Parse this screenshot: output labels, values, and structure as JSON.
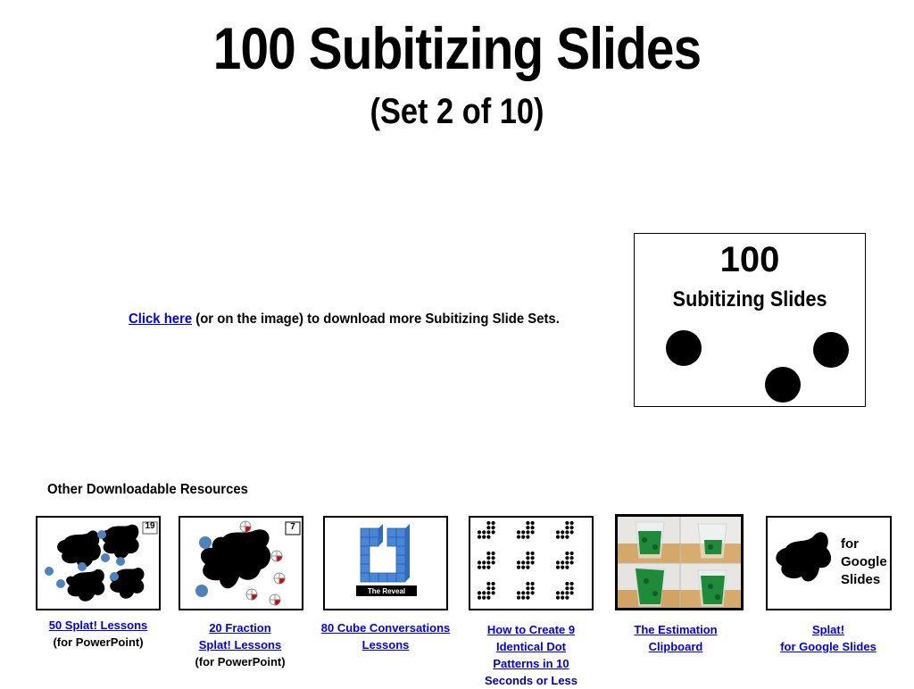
{
  "header": {
    "title": "100 Subitizing Slides",
    "subtitle": "(Set 2 of 10)"
  },
  "download": {
    "link_label": "Click here",
    "rest_text": " (or on the image) to download more Subitizing Slide Sets."
  },
  "promo_image": {
    "number": "100",
    "label": "Subitizing Slides",
    "dot_count": 3
  },
  "resources": {
    "heading": "Other Downloadable Resources",
    "items": [
      {
        "name": "50 Splat! Lessons",
        "link_lines": [
          "50 Splat! Lessons"
        ],
        "note": "(for PowerPoint)",
        "thumb_badge": "19",
        "thumb_icon": "splat-icon"
      },
      {
        "name": "20 Fraction Splat! Lessons",
        "link_lines": [
          "20 Fraction",
          "Splat! Lessons"
        ],
        "note": "(for PowerPoint)",
        "thumb_badge": "7",
        "thumb_icon": "fraction-splat-icon"
      },
      {
        "name": "80 Cube Conversations Lessons",
        "link_lines": [
          "80 Cube Conversations",
          "Lessons"
        ],
        "note": "",
        "thumb_label": "The Reveal",
        "thumb_icon": "cube-structure-icon"
      },
      {
        "name": "How to Create 9 Identical Dot Patterns in 10 Seconds or Less",
        "link_lines": [
          "How to Create 9",
          "Identical Dot",
          "Patterns in 10"
        ],
        "note": "Seconds or Less",
        "thumb_icon": "dot-pattern-icon"
      },
      {
        "name": "The Estimation Clipboard",
        "link_lines": [
          "The Estimation",
          "Clipboard"
        ],
        "note": "",
        "thumb_icon": "estimation-photo-icon"
      },
      {
        "name": "Splat! for Google Slides",
        "link_lines": [
          "Splat!",
          "for Google Slides"
        ],
        "note": "",
        "thumb_text": [
          "for",
          "Google",
          "Slides"
        ],
        "thumb_icon": "splat-icon"
      }
    ]
  },
  "colors": {
    "link": "#0000ee",
    "blue_dot": "#4f81bd",
    "fraction_red": "#e00000",
    "cube_blue": "#4a86d8"
  }
}
